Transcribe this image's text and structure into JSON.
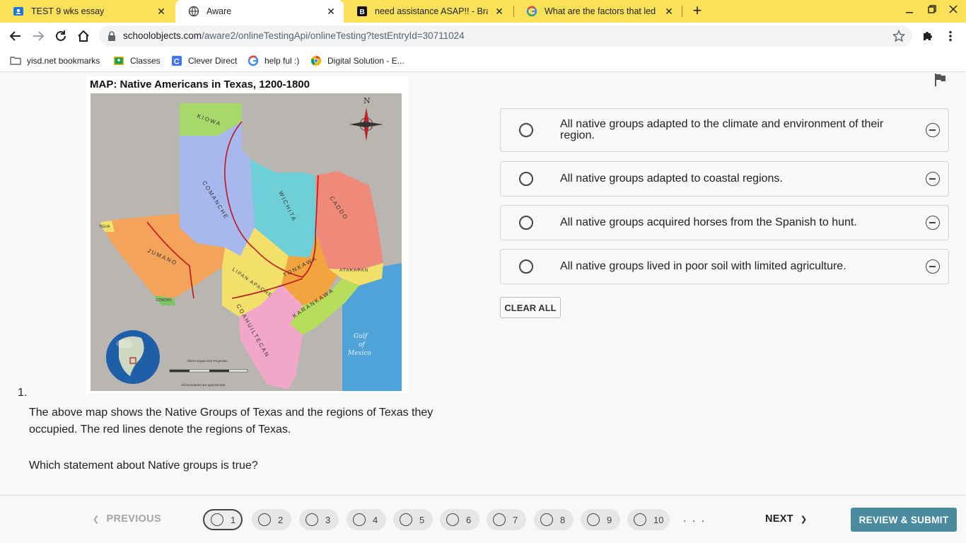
{
  "browser": {
    "tabs": [
      {
        "title": "TEST 9 wks essay",
        "active": false
      },
      {
        "title": "Aware",
        "active": true
      },
      {
        "title": "need assistance ASAP!! - Brainly",
        "active": false
      },
      {
        "title": "What are the factors that led to t",
        "active": false
      }
    ],
    "new_tab": "+",
    "url_host": "schoolobjects.com",
    "url_path": "/aware2/onlineTestingApi/onlineTesting?testEntryId=30711024"
  },
  "bookmarks": [
    {
      "label": "yisd.net bookmarks",
      "icon": "folder-icon"
    },
    {
      "label": "Classes",
      "icon": "google-classroom-icon"
    },
    {
      "label": "Clever Direct",
      "icon": "clever-icon"
    },
    {
      "label": "help ful :)",
      "icon": "google-icon"
    },
    {
      "label": "Digital Solution - E...",
      "icon": "chrome-icon"
    }
  ],
  "map": {
    "title": "MAP: Native Americans in Texas, 1200-1800",
    "groups": [
      "KIOWA",
      "COMANCHE",
      "WICHITA",
      "CADDO",
      "JUMANO",
      "LIPAN APACHE",
      "TONKAWA",
      "ATAKAPAN",
      "KARANKAWA",
      "COAHUILTECAN",
      "TIGUA",
      "CONCHO"
    ],
    "gulf_label": [
      "Gulf",
      "of",
      "Mexico"
    ],
    "compass_label": "N",
    "scale_note": "Albers Equal-Area Projection",
    "boundary_note": "All boundaries are approximate."
  },
  "question": {
    "number": "1.",
    "text": "The above map shows the Native Groups of Texas and the regions of Texas they occupied.   The red lines denote the regions of Texas.",
    "prompt": "Which statement about Native groups is true?"
  },
  "options": [
    {
      "text": "All native groups adapted to the climate and environment of their region."
    },
    {
      "text": "All native groups adapted to coastal regions."
    },
    {
      "text": "All native groups acquired horses from the Spanish to hunt."
    },
    {
      "text": "All native groups lived in poor soil with limited agriculture."
    }
  ],
  "clear_all": "CLEAR ALL",
  "nav": {
    "previous": "PREVIOUS",
    "next": "NEXT",
    "prev_arrow": "❮",
    "next_arrow": "❯",
    "pages": [
      "1",
      "2",
      "3",
      "4",
      "5",
      "6",
      "7",
      "8",
      "9",
      "10"
    ],
    "current_page": "1",
    "more": ". . .",
    "review_submit": "REVIEW & SUBMIT"
  },
  "colors": {
    "tabstrip": "#fbe158",
    "review_button": "#4a8ba0",
    "map_kiowa": "#a8d86a",
    "map_comanche": "#a7b8ee",
    "map_wichita": "#6fcfd6",
    "map_caddo": "#ef8a7a",
    "map_jumano": "#f4a35a",
    "map_lipan": "#f3e06a",
    "map_tonkawa": "#f3a43e",
    "map_karankawa": "#b6dc5c",
    "map_coahuiltecan": "#f2a6c9",
    "map_gulf": "#4fa3d9",
    "map_region_line": "#c0141c"
  }
}
